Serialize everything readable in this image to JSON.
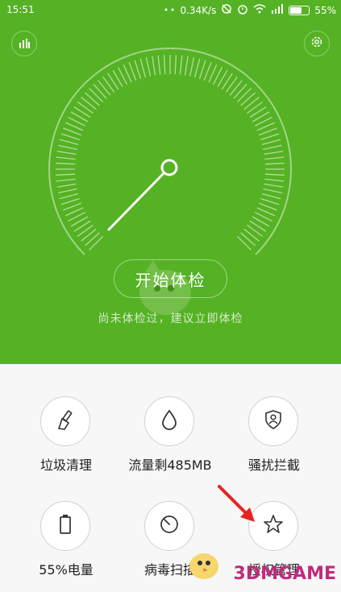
{
  "status_bar": {
    "time": "15:51",
    "network_speed": "0.34K/s",
    "battery_percent": "55%"
  },
  "hero": {
    "start_button_label": "开始体检",
    "hint_text": "尚未体检过，建议立即体检"
  },
  "tiles": [
    {
      "label": "垃圾清理",
      "icon": "broom-icon"
    },
    {
      "label": "流量剩485MB",
      "icon": "droplet-icon"
    },
    {
      "label": "骚扰拦截",
      "icon": "shield-user-icon"
    },
    {
      "label": "55%电量",
      "icon": "battery-icon"
    },
    {
      "label": "病毒扫描",
      "icon": "scan-dial-icon"
    },
    {
      "label": "授权管理",
      "icon": "star-icon"
    }
  ],
  "watermark": "3DMGAME",
  "colors": {
    "hero_green": "#55b224",
    "arrow_red": "#e8231f",
    "watermark": "#c22a7d"
  }
}
